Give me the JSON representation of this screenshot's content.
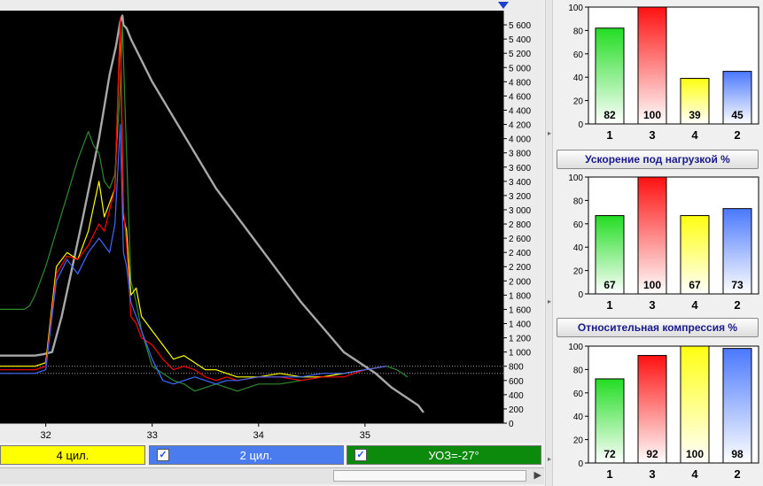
{
  "legend": {
    "cyl4": "4 цил.",
    "cyl2": "2 цил.",
    "uoz": "УОЗ=-27°",
    "check": "✓"
  },
  "chart_data": [
    {
      "type": "line",
      "x_ticks": [
        "32",
        "33",
        "34",
        "35"
      ],
      "xlim": [
        31.57,
        36.3
      ],
      "ylim": [
        0,
        5800
      ],
      "y_ticks": [
        "0",
        "200",
        "400",
        "600",
        "800",
        "1 000",
        "1 200",
        "1 400",
        "1 600",
        "1 800",
        "2 000",
        "2 200",
        "2 400",
        "2 600",
        "2 800",
        "3 000",
        "3 200",
        "3 400",
        "3 600",
        "3 800",
        "4 000",
        "4 200",
        "4 400",
        "4 600",
        "4 800",
        "5 000",
        "5 200",
        "5 400",
        "5 600"
      ],
      "reference_lines": [
        800,
        700
      ],
      "series": [
        {
          "color": "#a8a8a8",
          "x": [
            31.57,
            31.9,
            31.98,
            32.06,
            32.15,
            32.25,
            32.35,
            32.5,
            32.6,
            32.66,
            32.7,
            32.72,
            32.73,
            32.76,
            32.8,
            32.9,
            33.0,
            33.2,
            33.4,
            33.6,
            33.8,
            34.0,
            34.2,
            34.4,
            34.6,
            34.8,
            35.0,
            35.1,
            35.25,
            35.4,
            35.5,
            35.55
          ],
          "y": [
            950,
            950,
            970,
            1000,
            1500,
            2200,
            2900,
            4000,
            4900,
            5300,
            5650,
            5730,
            5600,
            5550,
            5400,
            5100,
            4800,
            4300,
            3800,
            3300,
            2900,
            2500,
            2100,
            1700,
            1350,
            1000,
            800,
            700,
            500,
            350,
            250,
            150
          ]
        },
        {
          "color": "#2e8b2e",
          "x": [
            31.57,
            31.8,
            31.85,
            31.9,
            32.0,
            32.1,
            32.2,
            32.3,
            32.4,
            32.45,
            32.5,
            32.55,
            32.6,
            32.65,
            32.7,
            32.72,
            32.75,
            32.8,
            32.85,
            32.9,
            33.0,
            33.1,
            33.2,
            33.3,
            33.4,
            33.5,
            33.6,
            33.7,
            33.8,
            33.9,
            34.0,
            34.2,
            34.4,
            34.6,
            34.8,
            35.0,
            35.2,
            35.3,
            35.4
          ],
          "y": [
            1600,
            1600,
            1650,
            1800,
            2200,
            2700,
            3200,
            3700,
            4100,
            3900,
            3800,
            3400,
            3300,
            3500,
            4700,
            5600,
            4200,
            2000,
            1700,
            1300,
            800,
            700,
            600,
            550,
            450,
            500,
            550,
            500,
            450,
            500,
            550,
            550,
            600,
            650,
            700,
            750,
            800,
            750,
            650
          ]
        },
        {
          "color": "#ffff00",
          "x": [
            31.57,
            31.9,
            32.0,
            32.1,
            32.2,
            32.3,
            32.4,
            32.5,
            32.55,
            32.6,
            32.65,
            32.7,
            32.73,
            32.76,
            32.8,
            32.85,
            32.9,
            33.0,
            33.1,
            33.2,
            33.3,
            33.4,
            33.5,
            33.6,
            33.7,
            33.8,
            34.0,
            34.2,
            34.4,
            34.6,
            34.8,
            35.0,
            35.2
          ],
          "y": [
            800,
            800,
            850,
            2200,
            2400,
            2300,
            2700,
            3400,
            2900,
            3100,
            3300,
            5600,
            2900,
            2700,
            1800,
            1900,
            1500,
            1300,
            1100,
            900,
            950,
            850,
            750,
            750,
            700,
            650,
            650,
            700,
            650,
            650,
            700,
            750,
            800
          ]
        },
        {
          "color": "#ff0000",
          "x": [
            31.57,
            31.9,
            32.0,
            32.1,
            32.2,
            32.3,
            32.4,
            32.5,
            32.55,
            32.6,
            32.65,
            32.7,
            32.73,
            32.76,
            32.8,
            32.85,
            32.9,
            33.0,
            33.1,
            33.2,
            33.3,
            33.4,
            33.5,
            33.6,
            33.7,
            33.8,
            34.0,
            34.2,
            34.4,
            34.6,
            34.8,
            35.0,
            35.2
          ],
          "y": [
            750,
            750,
            800,
            2100,
            2350,
            2300,
            2500,
            2800,
            2700,
            3000,
            3300,
            5700,
            3000,
            2500,
            1500,
            1400,
            1200,
            1100,
            900,
            750,
            800,
            750,
            650,
            600,
            650,
            600,
            650,
            650,
            600,
            650,
            650,
            750,
            800
          ]
        },
        {
          "color": "#4169ff",
          "x": [
            31.57,
            31.9,
            32.0,
            32.1,
            32.2,
            32.3,
            32.4,
            32.5,
            32.55,
            32.6,
            32.65,
            32.7,
            32.73,
            32.76,
            32.8,
            32.85,
            32.9,
            33.0,
            33.1,
            33.2,
            33.3,
            33.4,
            33.5,
            33.6,
            33.7,
            33.8,
            34.0,
            34.2,
            34.4,
            34.6,
            34.8,
            35.0,
            35.2
          ],
          "y": [
            700,
            700,
            750,
            2000,
            2300,
            2100,
            2400,
            2600,
            2500,
            2400,
            2800,
            4200,
            2400,
            2200,
            1700,
            1500,
            1300,
            900,
            600,
            550,
            600,
            650,
            600,
            550,
            600,
            600,
            650,
            650,
            650,
            700,
            700,
            750,
            800
          ]
        }
      ]
    },
    {
      "type": "bar",
      "ylim": [
        0,
        100
      ],
      "y_ticks": [
        "0",
        "20",
        "40",
        "60",
        "80",
        "100"
      ],
      "categories": [
        "1",
        "3",
        "4",
        "2"
      ],
      "values": [
        82,
        100,
        39,
        45
      ],
      "value_labels": [
        "82",
        "100",
        "39",
        "45"
      ],
      "colors": [
        "#22dd22",
        "#ff1111",
        "#ffff11",
        "#4a78ff"
      ]
    },
    {
      "type": "bar",
      "title": "Ускорение под нагрузкой %",
      "ylim": [
        0,
        100
      ],
      "y_ticks": [
        "0",
        "20",
        "40",
        "60",
        "80",
        "100"
      ],
      "categories": [
        "1",
        "3",
        "4",
        "2"
      ],
      "values": [
        67,
        100,
        67,
        73
      ],
      "value_labels": [
        "67",
        "100",
        "67",
        "73"
      ],
      "colors": [
        "#22dd22",
        "#ff1111",
        "#ffff11",
        "#4a78ff"
      ]
    },
    {
      "type": "bar",
      "title": "Относительная компрессия %",
      "ylim": [
        0,
        100
      ],
      "y_ticks": [
        "0",
        "20",
        "40",
        "60",
        "80",
        "100"
      ],
      "categories": [
        "1",
        "3",
        "4",
        "2"
      ],
      "values": [
        72,
        92,
        100,
        98
      ],
      "value_labels": [
        "72",
        "92",
        "100",
        "98"
      ],
      "colors": [
        "#22dd22",
        "#ff1111",
        "#ffff11",
        "#4a78ff"
      ]
    }
  ]
}
